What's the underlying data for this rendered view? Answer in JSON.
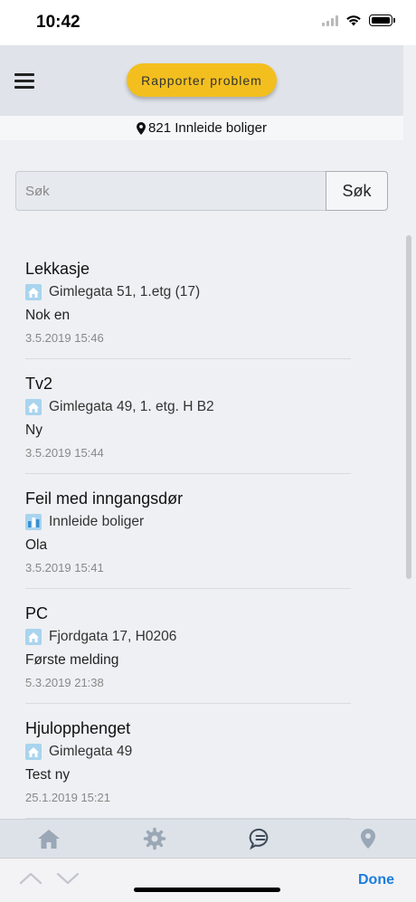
{
  "status_bar": {
    "time": "10:42"
  },
  "header": {
    "report_button": "Rapporter problem"
  },
  "location": {
    "label": "821 Innleide boliger"
  },
  "search": {
    "placeholder": "Søk",
    "button": "Søk"
  },
  "items": [
    {
      "title": "Lekkasje",
      "location": "Gimlegata 51, 1.etg (17)",
      "description": "Nok en",
      "date": "3.5.2019 15:46",
      "icon": "house-icon"
    },
    {
      "title": "Tv2",
      "location": "Gimlegata 49, 1. etg. H B2",
      "description": "Ny",
      "date": "3.5.2019 15:44",
      "icon": "house-icon"
    },
    {
      "title": "Feil med inngangsdør",
      "location": "Innleide boliger",
      "description": "Ola",
      "date": "3.5.2019 15:41",
      "icon": "bar-chart-icon"
    },
    {
      "title": "PC",
      "location": "Fjordgata 17, H0206",
      "description": "Første melding",
      "date": "5.3.2019 21:38",
      "icon": "house-icon"
    },
    {
      "title": "Hjulopphenget",
      "location": "Gimlegata 49",
      "description": "Test ny",
      "date": "25.1.2019 15:21",
      "icon": "house-icon"
    }
  ],
  "tabbar": {
    "tabs": [
      "home-icon",
      "gear-icon",
      "chat-icon",
      "location-pin-icon"
    ],
    "active": "chat-icon"
  },
  "keyboard_accessory": {
    "done": "Done"
  },
  "colors": {
    "accent": "#f3bf1f",
    "link": "#1a7de0",
    "header_bg": "#e0e4ea"
  }
}
